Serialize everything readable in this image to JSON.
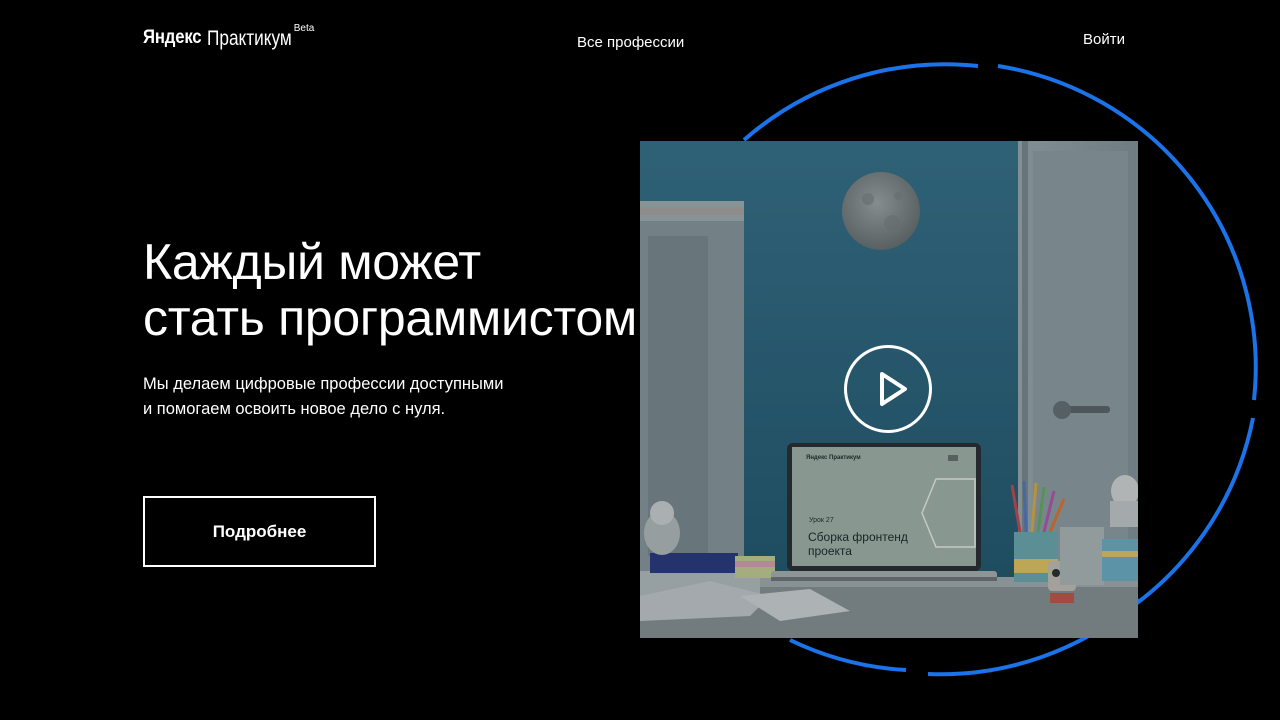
{
  "header": {
    "logo_brand": "Яндекс",
    "logo_product": "Практикум",
    "logo_badge": "Beta",
    "nav_professions": "Все профессии",
    "login": "Войти"
  },
  "hero": {
    "title_line1": "Каждый может",
    "title_line2": "стать программистом",
    "subtitle_line1": "Мы делаем цифровые профессии доступными",
    "subtitle_line2": "и помогаем освоить новое дело с нуля.",
    "more_button": "Подробнее"
  },
  "video": {
    "screen_logo": "Яндекс Практикум",
    "screen_lesson": "Урок 27",
    "screen_title": "Сборка фронтенд проекта",
    "play_icon": "play-icon"
  },
  "colors": {
    "background": "#000000",
    "accent_ring": "#1a73e8",
    "text": "#ffffff",
    "wall": "#2e6a86"
  }
}
